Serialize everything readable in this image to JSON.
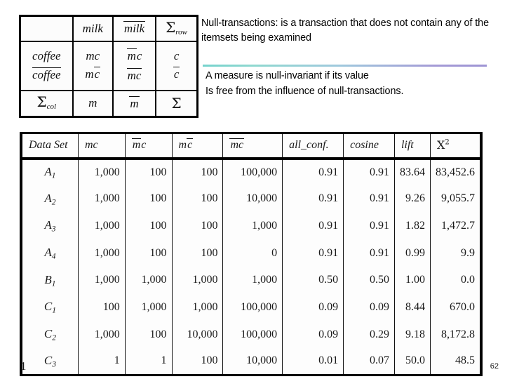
{
  "slide": {
    "page_number": "62",
    "left_edge_glyph": "1",
    "accent_rule_from": "#76d3cd",
    "accent_rule_to": "#9d94d4"
  },
  "text_blocks": {
    "null_transactions": "Null-transactions: is a  transaction that does not contain any of the itemsets being examined",
    "null_invariant_line1": "A measure is null-invariant if its value",
    "null_invariant_line2": "Is free from the influence of null-transactions."
  },
  "contingency_table": {
    "corner": "",
    "col_headers": [
      "milk",
      "milk",
      "Σrow"
    ],
    "col_header_overline": [
      false,
      true,
      false
    ],
    "row_label_top": "coffee",
    "row_label_bottom": "coffee",
    "cells": {
      "r1": [
        "mc",
        "mc",
        "c"
      ],
      "r2": [
        "mc",
        "mc",
        "c"
      ]
    },
    "footer": [
      "Σcol",
      "m",
      "m",
      "Σ"
    ]
  },
  "data_table": {
    "columns": [
      "Data Set",
      "mc",
      "mc",
      "mc",
      "mc",
      "all_conf.",
      "cosine",
      "lift",
      "X2"
    ],
    "rows": [
      {
        "data_set": "A",
        "sub": "1",
        "mc": "1,000",
        "mbarc": "100",
        "mcbar": "100",
        "mbarcbar": "100,000",
        "all_conf": "0.91",
        "cosine": "0.91",
        "lift": "83.64",
        "chi2": "83,452.6"
      },
      {
        "data_set": "A",
        "sub": "2",
        "mc": "1,000",
        "mbarc": "100",
        "mcbar": "100",
        "mbarcbar": "10,000",
        "all_conf": "0.91",
        "cosine": "0.91",
        "lift": "9.26",
        "chi2": "9,055.7"
      },
      {
        "data_set": "A",
        "sub": "3",
        "mc": "1,000",
        "mbarc": "100",
        "mcbar": "100",
        "mbarcbar": "1,000",
        "all_conf": "0.91",
        "cosine": "0.91",
        "lift": "1.82",
        "chi2": "1,472.7"
      },
      {
        "data_set": "A",
        "sub": "4",
        "mc": "1,000",
        "mbarc": "100",
        "mcbar": "100",
        "mbarcbar": "0",
        "all_conf": "0.91",
        "cosine": "0.91",
        "lift": "0.99",
        "chi2": "9.9"
      },
      {
        "data_set": "B",
        "sub": "1",
        "mc": "1,000",
        "mbarc": "1,000",
        "mcbar": "1,000",
        "mbarcbar": "1,000",
        "all_conf": "0.50",
        "cosine": "0.50",
        "lift": "1.00",
        "chi2": "0.0"
      },
      {
        "data_set": "C",
        "sub": "1",
        "mc": "100",
        "mbarc": "1,000",
        "mcbar": "1,000",
        "mbarcbar": "100,000",
        "all_conf": "0.09",
        "cosine": "0.09",
        "lift": "8.44",
        "chi2": "670.0"
      },
      {
        "data_set": "C",
        "sub": "2",
        "mc": "1,000",
        "mbarc": "100",
        "mcbar": "10,000",
        "mbarcbar": "100,000",
        "all_conf": "0.09",
        "cosine": "0.29",
        "lift": "9.18",
        "chi2": "8,172.8"
      },
      {
        "data_set": "C",
        "sub": "3",
        "mc": "1",
        "mbarc": "1",
        "mcbar": "100",
        "mbarcbar": "10,000",
        "all_conf": "0.01",
        "cosine": "0.07",
        "lift": "50.0",
        "chi2": "48.5"
      }
    ]
  }
}
